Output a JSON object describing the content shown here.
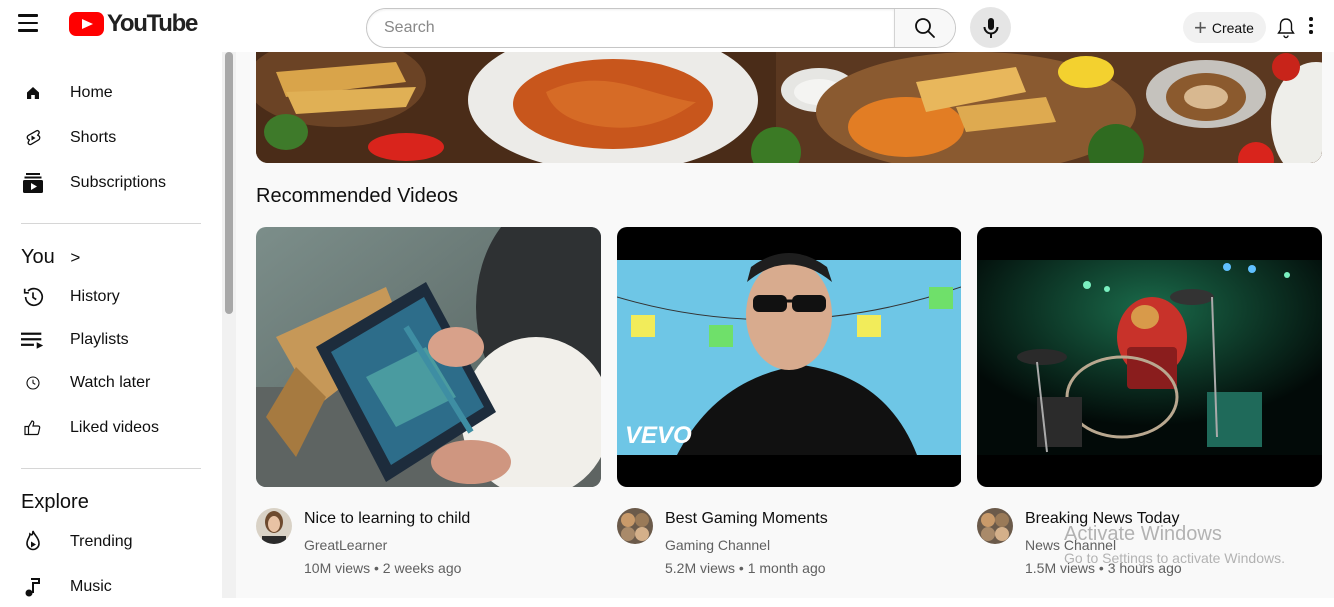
{
  "header": {
    "logo_text": "YouTube",
    "search_placeholder": "Search",
    "create_label": "Create"
  },
  "sidebar": {
    "main_items": [
      {
        "label": "Home",
        "icon": "home-icon"
      },
      {
        "label": "Shorts",
        "icon": "shorts-icon"
      },
      {
        "label": "Subscriptions",
        "icon": "subscriptions-icon"
      }
    ],
    "you_heading": "You",
    "you_chevron": ">",
    "you_items": [
      {
        "label": "History",
        "icon": "history-icon"
      },
      {
        "label": "Playlists",
        "icon": "playlists-icon"
      },
      {
        "label": "Watch later",
        "icon": "watch-later-icon"
      },
      {
        "label": "Liked videos",
        "icon": "like-icon"
      }
    ],
    "explore_heading": "Explore",
    "explore_items": [
      {
        "label": "Trending",
        "icon": "trending-icon"
      },
      {
        "label": "Music",
        "icon": "music-icon"
      }
    ]
  },
  "main": {
    "section_title": "Recommended Videos",
    "videos": [
      {
        "title": "Nice to learning to child",
        "channel": "GreatLearner",
        "stats": "10M views • 2 weeks ago"
      },
      {
        "title": "Best Gaming Moments",
        "channel": "Gaming Channel",
        "stats": "5.2M views • 1 month ago"
      },
      {
        "title": "Breaking News Today",
        "channel": "News Channel",
        "stats": "1.5M views • 3 hours ago"
      }
    ],
    "thumbnail_overlay_text": "VEVO"
  },
  "overlay": {
    "activate_title": "Activate Windows",
    "activate_sub": "Go to Settings to activate Windows."
  },
  "colors": {
    "brand_red": "#ff0000",
    "text_primary": "#0f0f0f",
    "text_secondary": "#606060",
    "page_bg": "#f9f9f9"
  }
}
